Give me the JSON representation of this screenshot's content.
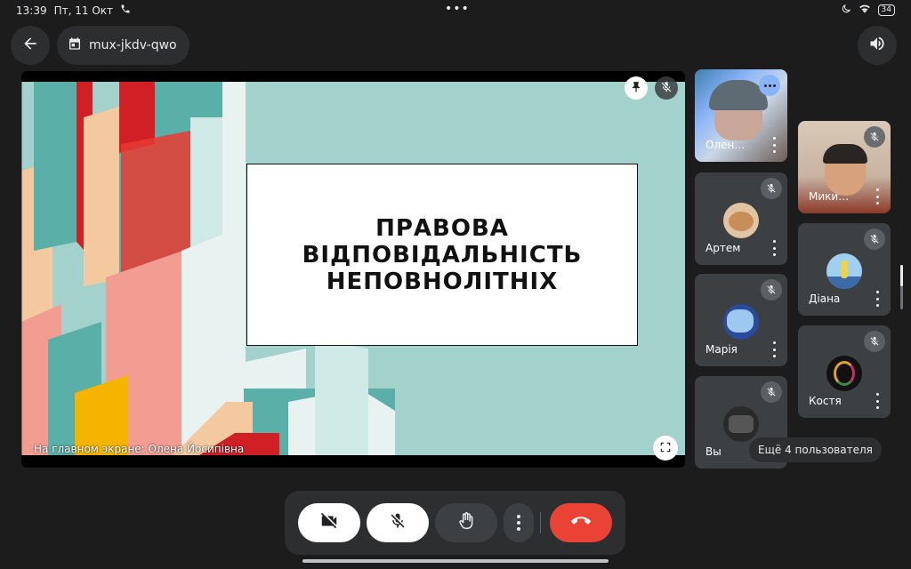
{
  "status_bar": {
    "time": "13:39",
    "date": "Пт, 11 Окт",
    "dots": "•••",
    "battery": "34"
  },
  "header": {
    "meeting_code": "mux-jkdv-qwo",
    "icons": [
      "arrow-back-icon",
      "calendar-icon",
      "volume-icon"
    ]
  },
  "stage": {
    "slide_title": "ПРАВОВА\nВІДПОВІДАЛЬНІСТЬ\nНЕПОВНОЛІТНІХ",
    "caption": "На главном экране: Олена Йосипівна"
  },
  "participants": [
    {
      "name": "Олен…",
      "active": true
    },
    {
      "name": "Мики…"
    },
    {
      "name": "Артем"
    },
    {
      "name": "Діана"
    },
    {
      "name": "Марія"
    },
    {
      "name": "Костя"
    },
    {
      "name": "Вы"
    }
  ],
  "more_users_label": "Ещё 4 пользователя",
  "controls": [
    "camera-off",
    "mic-off",
    "raise-hand",
    "more-options",
    "hang-up"
  ],
  "colors": {
    "background": "#1c1c1c",
    "surface": "#2d2e30",
    "tile": "#3c4043",
    "hang_up": "#ea4335",
    "active_outline": "#8ab4f8",
    "slide_bg": "#a3d2cc"
  }
}
